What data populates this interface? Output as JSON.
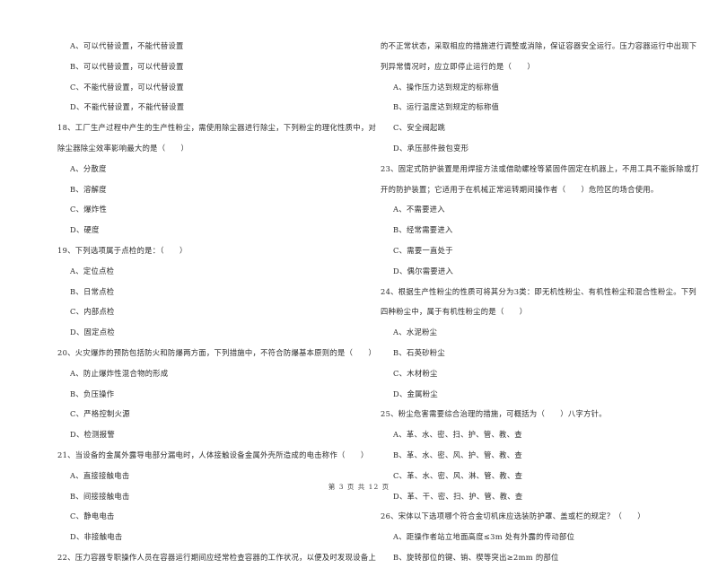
{
  "left_column": {
    "lines": [
      {
        "type": "option",
        "text": "A、可以代替设置，不能代替设置"
      },
      {
        "type": "option",
        "text": "B、可以代替设置，可以代替设置"
      },
      {
        "type": "option",
        "text": "C、不能代替设置，可以代替设置"
      },
      {
        "type": "option",
        "text": "D、不能代替设置，不能代替设置"
      },
      {
        "type": "question",
        "text": "18、工厂生产过程中产生的生产性粉尘，需使用除尘器进行除尘，下列粉尘的理化性质中，对"
      },
      {
        "type": "continuation",
        "text": "除尘器除尘效率影响最大的是（　　）"
      },
      {
        "type": "option",
        "text": "A、分散度"
      },
      {
        "type": "option",
        "text": "B、溶解度"
      },
      {
        "type": "option",
        "text": "C、爆炸性"
      },
      {
        "type": "option",
        "text": "D、硬度"
      },
      {
        "type": "question",
        "text": "19、下列选项属于点检的是：（　　）"
      },
      {
        "type": "option",
        "text": "A、定位点检"
      },
      {
        "type": "option",
        "text": "B、日常点检"
      },
      {
        "type": "option",
        "text": "C、内部点检"
      },
      {
        "type": "option",
        "text": "D、固定点检"
      },
      {
        "type": "question",
        "text": "20、火灾爆炸的预防包括防火和防爆两方面，下列措施中，不符合防爆基本原则的是（　　）"
      },
      {
        "type": "option",
        "text": "A、防止爆炸性混合物的形成"
      },
      {
        "type": "option",
        "text": "B、负压操作"
      },
      {
        "type": "option",
        "text": "C、严格控制火源"
      },
      {
        "type": "option",
        "text": "D、检测报警"
      },
      {
        "type": "question",
        "text": "21、当设备的金属外露导电部分漏电时，人体接触设备金属外壳所造成的电击称作（　　）"
      },
      {
        "type": "option",
        "text": "A、直接接触电击"
      },
      {
        "type": "option",
        "text": "B、间接接触电击"
      },
      {
        "type": "option",
        "text": "C、静电电击"
      },
      {
        "type": "option",
        "text": "D、非接触电击"
      },
      {
        "type": "question",
        "text": "22、压力容器专职操作人员在容器运行期间应经常检查容器的工作状况，以便及时发现设备上"
      }
    ]
  },
  "right_column": {
    "lines": [
      {
        "type": "continuation",
        "text": "的不正常状态，采取相应的措施进行调整或消除，保证容器安全运行。压力容器运行中出现下"
      },
      {
        "type": "continuation",
        "text": "列异常情况时，应立即停止运行的是（　　）"
      },
      {
        "type": "option",
        "text": "A、操作压力达到规定的标称值"
      },
      {
        "type": "option",
        "text": "B、运行温度达到规定的标称值"
      },
      {
        "type": "option",
        "text": "C、安全阀起跳"
      },
      {
        "type": "option",
        "text": "D、承压部件鼓包变形"
      },
      {
        "type": "question",
        "text": "23、固定式防护装置是用焊接方法或借助螺栓等紧固件固定在机器上，不用工具不能拆除或打"
      },
      {
        "type": "continuation",
        "text": "开的防护装置；它适用于在机械正常运转期间操作者（　　）危险区的场合使用。"
      },
      {
        "type": "option",
        "text": "A、不需要进入"
      },
      {
        "type": "option",
        "text": "B、经常需要进入"
      },
      {
        "type": "option",
        "text": "C、需要一直处于"
      },
      {
        "type": "option",
        "text": "D、偶尔需要进入"
      },
      {
        "type": "question",
        "text": "24、根据生产性粉尘的性质可将其分为3类：即无机性粉尘、有机性粉尘和混合性粉尘。下列"
      },
      {
        "type": "continuation",
        "text": "四种粉尘中，属于有机性粉尘的是（　　）"
      },
      {
        "type": "option",
        "text": "A、水泥粉尘"
      },
      {
        "type": "option",
        "text": "B、石英砂粉尘"
      },
      {
        "type": "option",
        "text": "C、木材粉尘"
      },
      {
        "type": "option",
        "text": "D、金属粉尘"
      },
      {
        "type": "question",
        "text": "25、粉尘危害需要综合治理的措施，可概括为（　　）八字方针。"
      },
      {
        "type": "option",
        "text": "A、革、水、密、扫、护、管、教、查"
      },
      {
        "type": "option",
        "text": "B、革、水、密、风、护、管、教、查"
      },
      {
        "type": "option",
        "text": "C、革、水、密、风、淋、管、教、查"
      },
      {
        "type": "option",
        "text": "D、革、干、密、扫、护、管、教、查"
      },
      {
        "type": "question",
        "text": "26、宋体以下选项哪个符合金切机床应选装防护罩、盖或栏的规定？（　　）"
      },
      {
        "type": "option",
        "text": "A、距操作者站立地面高度≤3m 处有外露的传动部位"
      },
      {
        "type": "option",
        "text": "B、旋转部位的键、销、楔等突出≥2mm 的部位"
      }
    ]
  },
  "footer": {
    "page_label": "第 3 页 共 12 页"
  }
}
